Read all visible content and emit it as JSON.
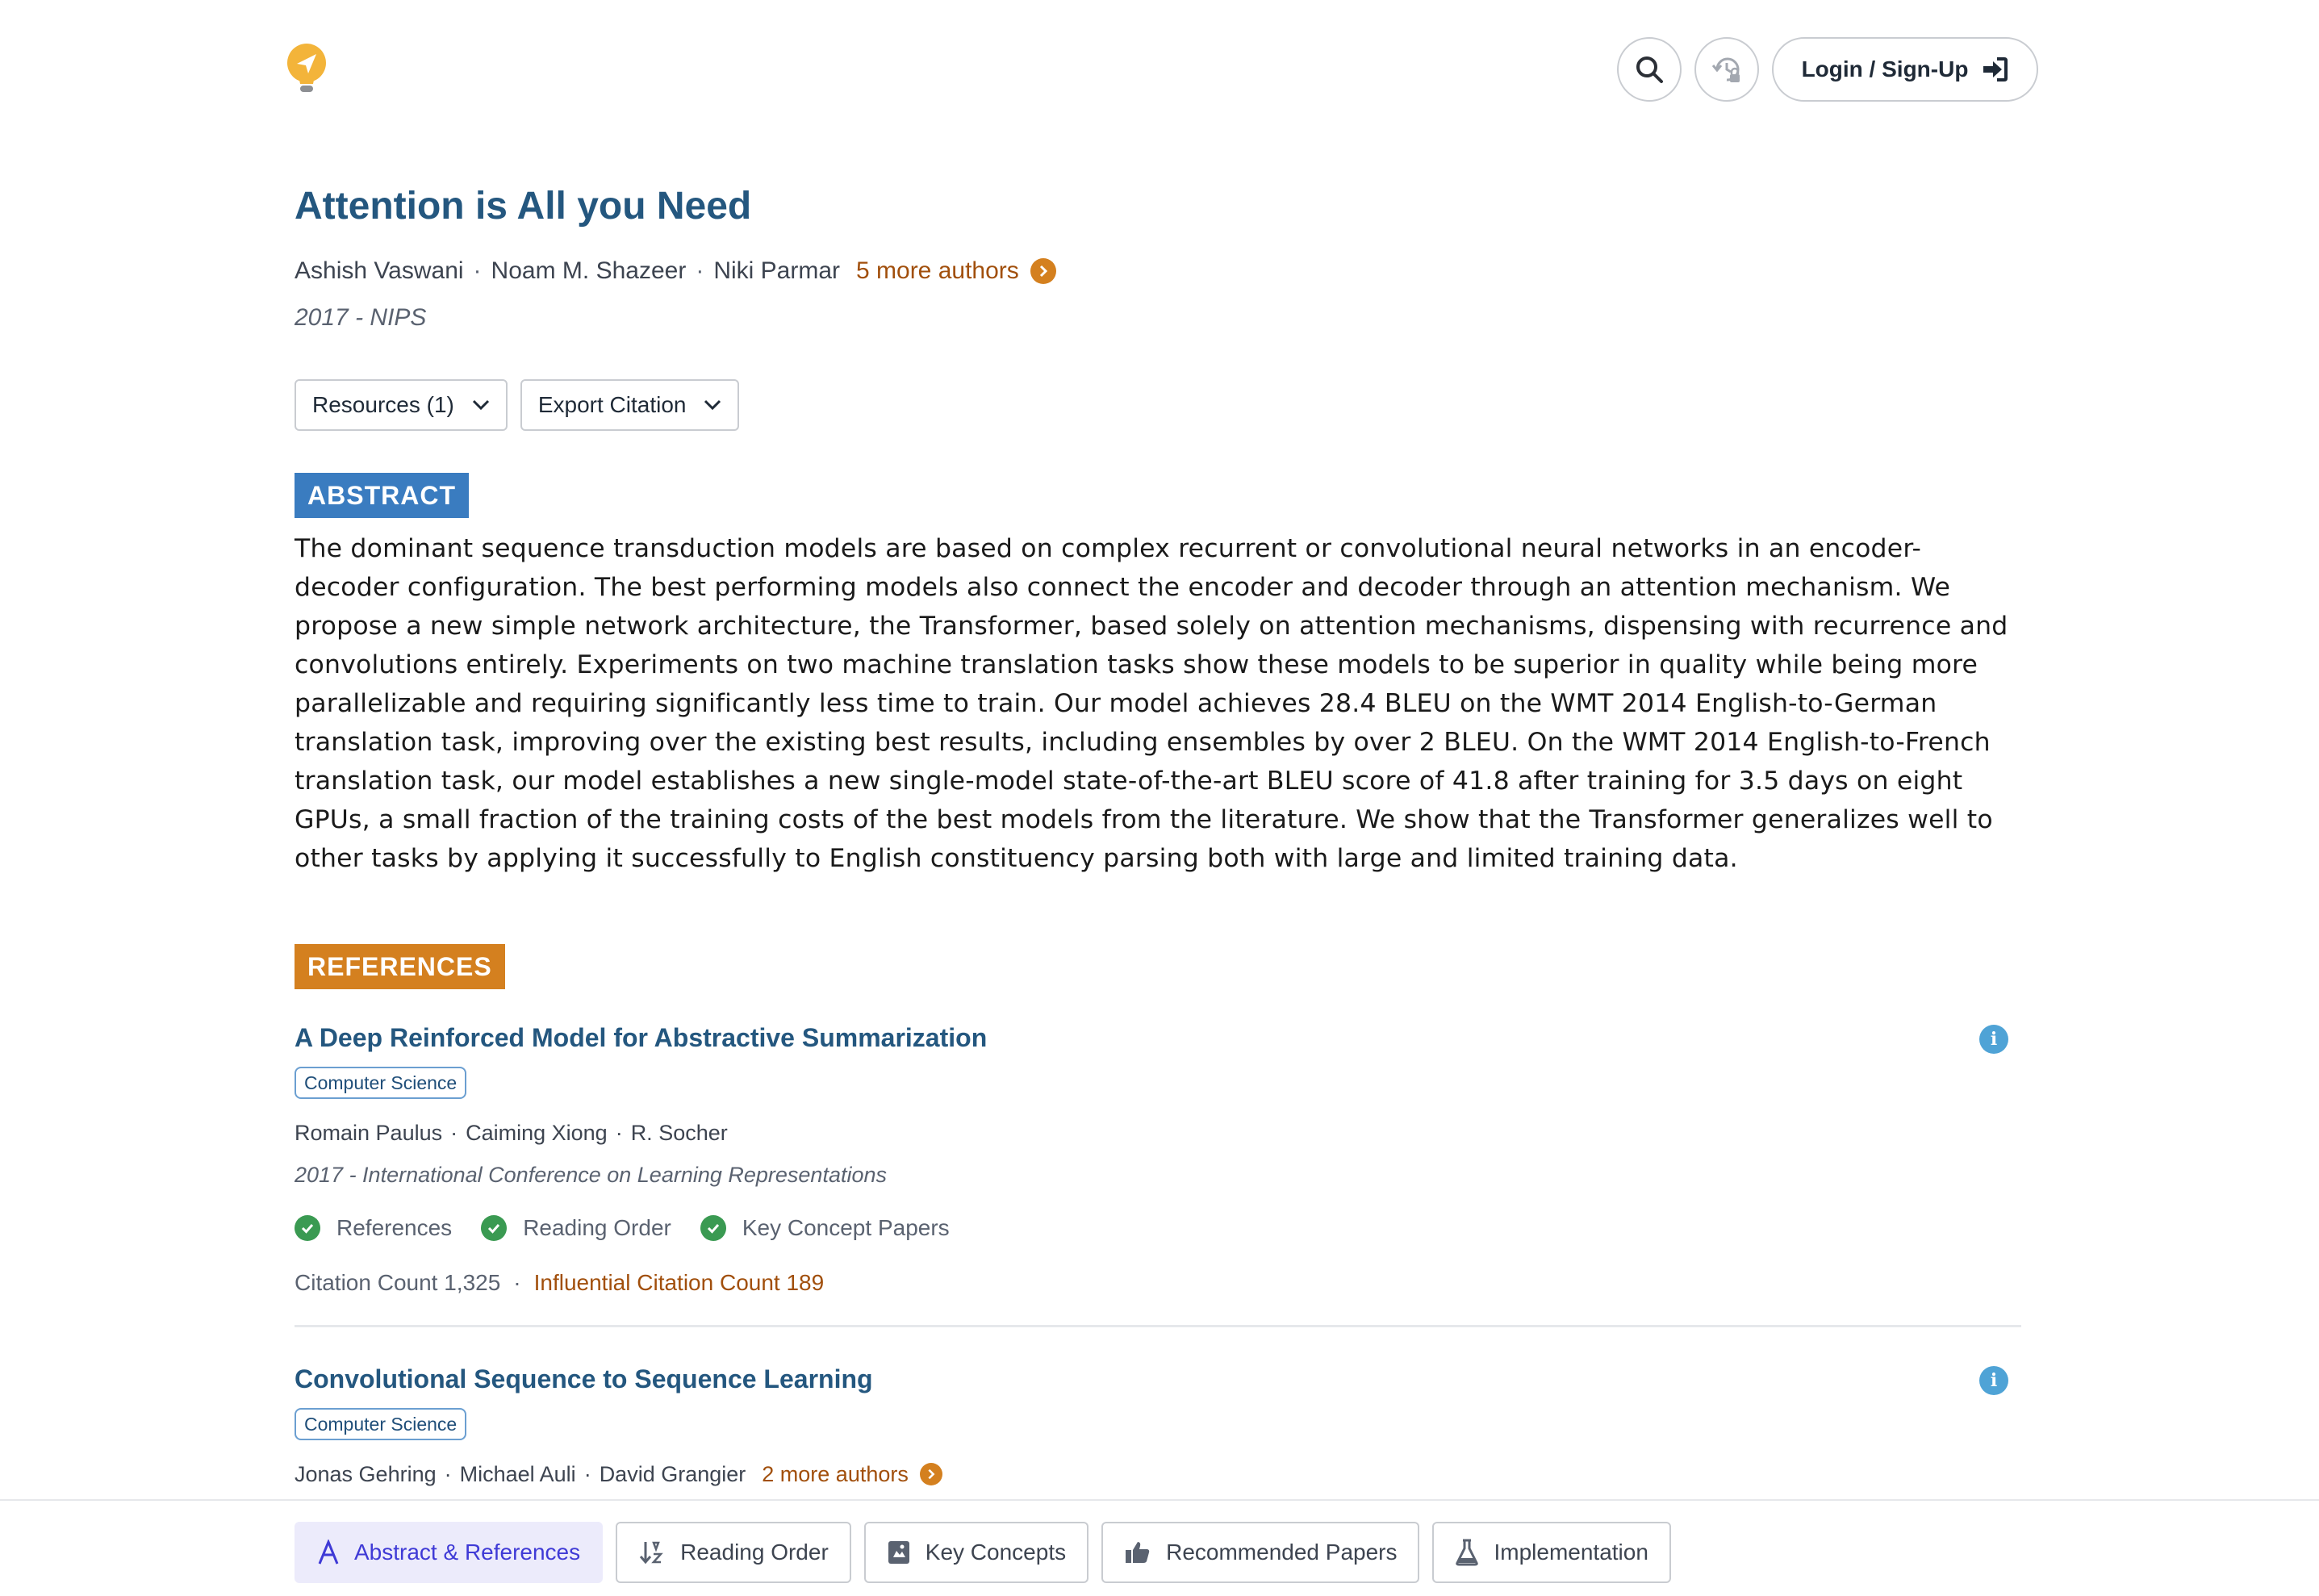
{
  "header": {
    "login_label": "Login / Sign-Up",
    "icons": [
      "logo-icon",
      "search-icon",
      "history-icon",
      "login-arrow-icon"
    ]
  },
  "paper": {
    "title": "Attention is All you Need",
    "authors": [
      "Ashish Vaswani",
      "Noam M. Shazeer",
      "Niki Parmar"
    ],
    "more_authors": "5 more authors",
    "venue": "2017 - NIPS",
    "resources_label": "Resources (1)",
    "export_label": "Export Citation"
  },
  "abstract": {
    "tag": "ABSTRACT",
    "text": "The dominant sequence transduction models are based on complex recurrent or convolutional neural networks in an encoder-decoder configuration. The best performing models also connect the encoder and decoder through an attention mechanism. We propose a new simple network architecture, the Transformer, based solely on attention mechanisms, dispensing with recurrence and convolutions entirely. Experiments on two machine translation tasks show these models to be superior in quality while being more parallelizable and requiring significantly less time to train. Our model achieves 28.4 BLEU on the WMT 2014 English-to-German translation task, improving over the existing best results, including ensembles by over 2 BLEU. On the WMT 2014 English-to-French translation task, our model establishes a new single-model state-of-the-art BLEU score of 41.8 after training for 3.5 days on eight GPUs, a small fraction of the training costs of the best models from the literature. We show that the Transformer generalizes well to other tasks by applying it successfully to English constituency parsing both with large and limited training data."
  },
  "references": {
    "tag": "REFERENCES",
    "items": [
      {
        "title": "A Deep Reinforced Model for Abstractive Summarization",
        "field": "Computer Science",
        "authors": [
          "Romain Paulus",
          "Caiming Xiong",
          "R. Socher"
        ],
        "venue": "2017 - International Conference on Learning Representations",
        "checks": [
          "References",
          "Reading Order",
          "Key Concept Papers"
        ],
        "citation_count": "Citation Count 1,325",
        "influential_count": "Influential Citation Count 189"
      },
      {
        "title": "Convolutional Sequence to Sequence Learning",
        "field": "Computer Science",
        "authors": [
          "Jonas Gehring",
          "Michael Auli",
          "David Grangier"
        ],
        "more_authors": "2 more authors"
      }
    ]
  },
  "tabs": [
    {
      "label": "Abstract & References",
      "icon": "abstract-icon",
      "active": true
    },
    {
      "label": "Reading Order",
      "icon": "sort-icon",
      "active": false
    },
    {
      "label": "Key Concepts",
      "icon": "concepts-icon",
      "active": false
    },
    {
      "label": "Recommended Papers",
      "icon": "thumbs-up-icon",
      "active": false
    },
    {
      "label": "Implementation",
      "icon": "flask-icon",
      "active": false
    }
  ],
  "colors": {
    "title_blue": "#24577f",
    "abstract_tag": "#3a7cc0",
    "references_tag": "#d4801f",
    "check_green": "#3a9a52",
    "accent_orange": "#a14f0c",
    "active_tab": "#3f3ad6"
  }
}
